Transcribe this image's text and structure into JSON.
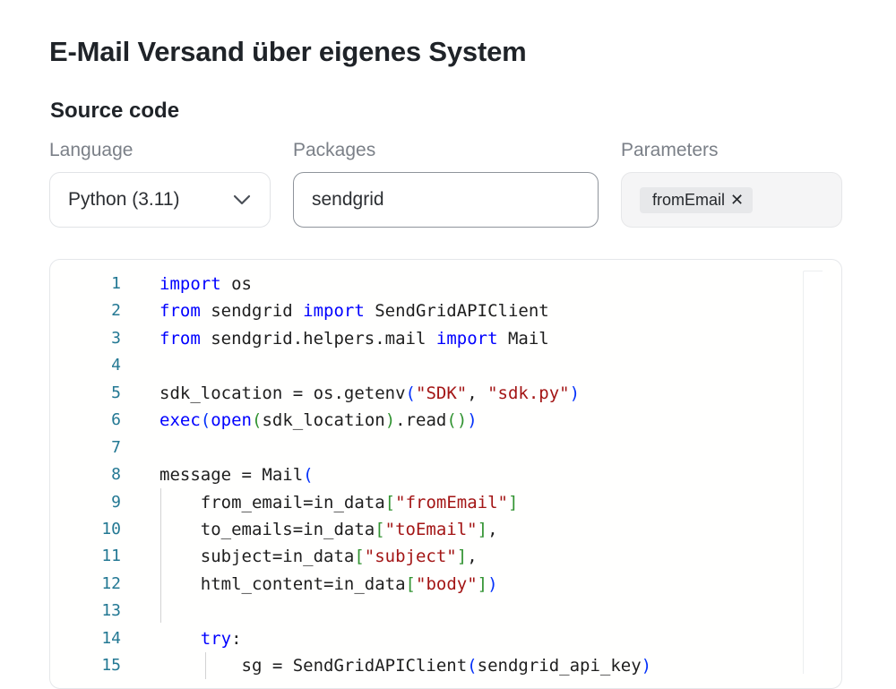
{
  "header": {
    "title": "E-Mail Versand über eigenes System"
  },
  "source": {
    "section_title": "Source code",
    "language": {
      "label": "Language",
      "value": "Python (3.11)"
    },
    "packages": {
      "label": "Packages",
      "value": "sendgrid"
    },
    "parameters": {
      "label": "Parameters",
      "chips": [
        "fromEmail"
      ],
      "remove_symbol": "✕"
    }
  },
  "editor": {
    "line_numbers": [
      "1",
      "2",
      "3",
      "4",
      "5",
      "6",
      "7",
      "8",
      "9",
      "10",
      "11",
      "12",
      "13",
      "14",
      "15"
    ],
    "lines": [
      [
        {
          "t": "import",
          "c": "kw"
        },
        {
          "t": " os"
        }
      ],
      [
        {
          "t": "from",
          "c": "kw"
        },
        {
          "t": " sendgrid "
        },
        {
          "t": "import",
          "c": "kw"
        },
        {
          "t": " SendGridAPIClient"
        }
      ],
      [
        {
          "t": "from",
          "c": "kw"
        },
        {
          "t": " sendgrid.helpers.mail "
        },
        {
          "t": "import",
          "c": "kw"
        },
        {
          "t": " Mail"
        }
      ],
      [],
      [
        {
          "t": "sdk_location = os.getenv"
        },
        {
          "t": "(",
          "c": "p1"
        },
        {
          "t": "\"SDK\"",
          "c": "str"
        },
        {
          "t": ", "
        },
        {
          "t": "\"sdk.py\"",
          "c": "str"
        },
        {
          "t": ")",
          "c": "p1"
        }
      ],
      [
        {
          "t": "exec",
          "c": "kw"
        },
        {
          "t": "(",
          "c": "p1"
        },
        {
          "t": "open",
          "c": "kw"
        },
        {
          "t": "(",
          "c": "p2"
        },
        {
          "t": "sdk_location"
        },
        {
          "t": ")",
          "c": "p2"
        },
        {
          "t": ".read"
        },
        {
          "t": "()",
          "c": "p2"
        },
        {
          "t": ")",
          "c": "p1"
        }
      ],
      [],
      [
        {
          "t": "message = Mail"
        },
        {
          "t": "(",
          "c": "p1"
        }
      ],
      [
        {
          "t": "    from_email=in_data"
        },
        {
          "t": "[",
          "c": "p2"
        },
        {
          "t": "\"fromEmail\"",
          "c": "str"
        },
        {
          "t": "]",
          "c": "p2"
        }
      ],
      [
        {
          "t": "    to_emails=in_data"
        },
        {
          "t": "[",
          "c": "p2"
        },
        {
          "t": "\"toEmail\"",
          "c": "str"
        },
        {
          "t": "]",
          "c": "p2"
        },
        {
          "t": ","
        }
      ],
      [
        {
          "t": "    subject=in_data"
        },
        {
          "t": "[",
          "c": "p2"
        },
        {
          "t": "\"subject\"",
          "c": "str"
        },
        {
          "t": "]",
          "c": "p2"
        },
        {
          "t": ","
        }
      ],
      [
        {
          "t": "    html_content=in_data"
        },
        {
          "t": "[",
          "c": "p2"
        },
        {
          "t": "\"body\"",
          "c": "str"
        },
        {
          "t": "]",
          "c": "p2"
        },
        {
          "t": ")",
          "c": "p1"
        }
      ],
      [],
      [
        {
          "t": "    "
        },
        {
          "t": "try",
          "c": "kw"
        },
        {
          "t": ":"
        }
      ],
      [
        {
          "t": "        sg = SendGridAPIClient"
        },
        {
          "t": "(",
          "c": "p1"
        },
        {
          "t": "sendgrid_api_key"
        },
        {
          "t": ")",
          "c": "p1"
        }
      ]
    ]
  },
  "colors": {
    "keyword": "#0000ff",
    "string": "#a31515",
    "line_number": "#237893",
    "bracket_level1": "#0431fa",
    "bracket_level2": "#319331"
  }
}
